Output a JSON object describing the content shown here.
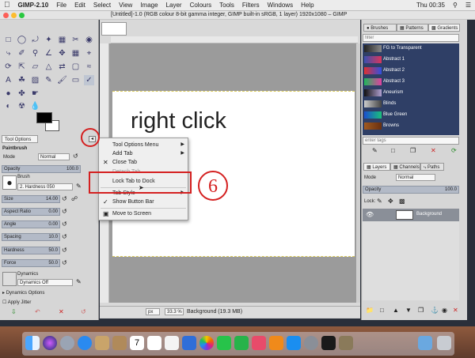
{
  "menubar": {
    "app": "GIMP-2.10",
    "items": [
      "File",
      "Edit",
      "Select",
      "View",
      "Image",
      "Layer",
      "Colours",
      "Tools",
      "Filters",
      "Windows",
      "Help"
    ],
    "clock": "Thu 00:35"
  },
  "window": {
    "title": "[Untitled]-1.0 (RGB colour 8-bit gamma integer, GIMP built-in sRGB, 1 layer) 1920x1080 – GIMP"
  },
  "toolbox": {
    "tab_label": "Tool Options",
    "tool_name": "Paintbrush",
    "mode_label": "Mode",
    "mode_value": "Normal",
    "opacity_label": "Opacity",
    "opacity_value": "100.0",
    "brush_label": "Brush",
    "brush_value": "2. Hardness 050",
    "size_label": "Size",
    "size_value": "14.00",
    "aspect_label": "Aspect Ratio",
    "aspect_value": "0.00",
    "angle_label": "Angle",
    "angle_value": "0.00",
    "spacing_label": "Spacing",
    "spacing_value": "10.0",
    "hardness_label": "Hardness",
    "hardness_value": "50.0",
    "force_label": "Force",
    "force_value": "50.0",
    "dynamics_label": "Dynamics",
    "dynamics_value": "Dynamics Off",
    "dynamics_options": "Dynamics Options",
    "apply_jitter": "Apply Jitter"
  },
  "canvas": {
    "text": "right click",
    "unit": "px",
    "zoom": "33.3 %",
    "status": "Background (19.3 MB)"
  },
  "context_menu": {
    "items": [
      {
        "label": "Tool Options Menu",
        "submenu": true
      },
      {
        "label": "Add Tab",
        "submenu": true
      },
      {
        "label": "Close Tab",
        "icon": "✕"
      },
      {
        "label": "Detach Tab",
        "disabled": true
      },
      {
        "label": "Lock Tab to Dock"
      },
      {
        "label": "Tab Style",
        "submenu": true
      },
      {
        "label": "Show Button Bar",
        "check": "✓"
      },
      {
        "label": "Move to Screen",
        "icon": "▣"
      }
    ]
  },
  "annotation": {
    "step": "6"
  },
  "dock_top": {
    "tabs": [
      "Brushes",
      "Patterns",
      "Gradients"
    ],
    "filter_placeholder": "filter",
    "tags_placeholder": "enter tags",
    "gradients": [
      {
        "name": "FG to Transparent",
        "colors": [
          "#222222",
          "#888888"
        ]
      },
      {
        "name": "Abstract 1",
        "colors": [
          "#3a4fb0",
          "#d9365a"
        ]
      },
      {
        "name": "Abstract 2",
        "colors": [
          "#e03030",
          "#3050e0"
        ]
      },
      {
        "name": "Abstract 3",
        "colors": [
          "#1fb65a",
          "#e040a0"
        ]
      },
      {
        "name": "Aneurism",
        "colors": [
          "#101010",
          "#b0a0d0"
        ]
      },
      {
        "name": "Blinds",
        "colors": [
          "#cccccc",
          "#444444"
        ]
      },
      {
        "name": "Blue Green",
        "colors": [
          "#1a4fd0",
          "#1ac07a"
        ]
      },
      {
        "name": "Browns",
        "colors": [
          "#a05a20",
          "#6a3010"
        ]
      }
    ]
  },
  "dock_bottom": {
    "tabs": [
      "Layers",
      "Channels",
      "Paths"
    ],
    "mode_label": "Mode",
    "mode_value": "Normal",
    "opacity_label": "Opacity",
    "opacity_value": "100.0",
    "lock_label": "Lock:",
    "layer_name": "Background"
  },
  "colors": {
    "annotation": "#d42020",
    "slider": "#b3bac7"
  }
}
